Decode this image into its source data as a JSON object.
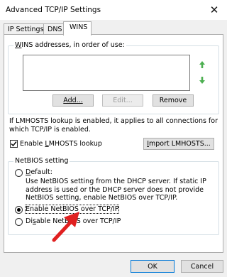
{
  "window": {
    "title": "Advanced TCP/IP Settings",
    "close_glyph": "✕"
  },
  "tabs": [
    {
      "label": "IP Settings",
      "active": false
    },
    {
      "label": "DNS",
      "active": false
    },
    {
      "label": "WINS",
      "active": true
    }
  ],
  "wins_group": {
    "label_prefix": "W",
    "label_rest": "INS addresses, in order of use:",
    "up_icon": "arrow-up-icon",
    "down_icon": "arrow-down-icon",
    "add_label": "Add...",
    "edit_label": "Edit...",
    "remove_label": "Remove"
  },
  "lmhosts": {
    "info": "If LMHOSTS lookup is enabled, it applies to all connections for which TCP/IP is enabled.",
    "checkbox_prefix": "Enable ",
    "checkbox_u": "L",
    "checkbox_rest": "MHOSTS lookup",
    "checked": true,
    "import_prefix": "I",
    "import_rest": "mport LMHOSTS..."
  },
  "netbios": {
    "group_label": "NetBIOS setting",
    "default_prefix": "D",
    "default_rest": "efault:",
    "default_desc": "Use NetBIOS setting from the DHCP server. If static IP address is used or the DHCP server does not provide NetBIOS setting, enable NetBIOS over TCP/IP.",
    "enable_label": "Enable NetBIOS over TCP/IP",
    "enable_u": "N",
    "disable_prefix": "Di",
    "disable_u": "s",
    "disable_rest": "able NetBIOS over TCP/IP",
    "selected": "enable"
  },
  "footer": {
    "ok_label": "OK",
    "cancel_label": "Cancel"
  },
  "colors": {
    "arrow_annotation": "#e02020",
    "accent": "#0078d7",
    "list_arrows": "#4caf50"
  }
}
